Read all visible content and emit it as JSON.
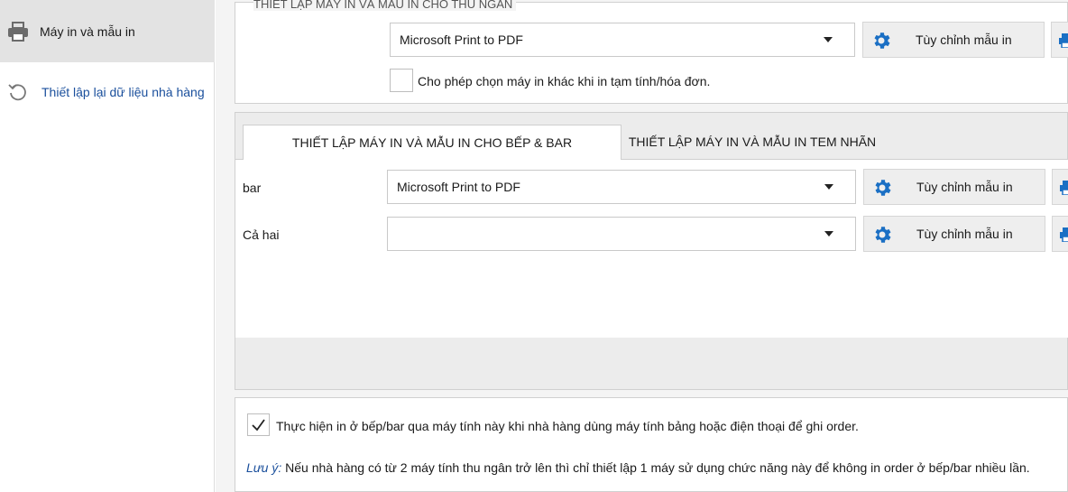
{
  "sidebar": {
    "items": [
      {
        "label": "Máy in và mẫu in",
        "icon": "printer-icon",
        "active": true
      },
      {
        "label": "Thiết lập lại dữ liệu nhà hàng",
        "icon": "reset-icon",
        "active": false
      }
    ]
  },
  "cashier": {
    "title": "THIẾT LẬP MÁY IN VÀ MẪU IN CHO THU NGÂN",
    "printer_value": "Microsoft Print to PDF",
    "customize_label": "Tùy chỉnh mẫu in",
    "allow_other_label": "Cho phép chọn máy in khác khi in tạm tính/hóa đơn.",
    "allow_other_checked": false
  },
  "tabs": [
    {
      "label": "THIẾT LẬP MÁY IN VÀ MẪU IN CHO BẾP & BAR",
      "active": true
    },
    {
      "label": "THIẾT LẬP MÁY IN VÀ MẪU IN TEM NHÃN",
      "active": false
    }
  ],
  "kitchen_rows": [
    {
      "label": "bar",
      "printer_value": "Microsoft Print to PDF",
      "customize_label": "Tùy chỉnh mẫu in"
    },
    {
      "label": "Cả hai",
      "printer_value": "",
      "customize_label": "Tùy chỉnh mẫu in"
    }
  ],
  "footer": {
    "remote_print_label": "Thực hiện in ở bếp/bar qua máy tính này khi nhà hàng dùng máy tính bảng hoặc điện thoại để ghi order.",
    "remote_print_checked": true,
    "note_prefix": "Lưu ý:",
    "note_text": " Nếu nhà hàng có từ 2 máy tính thu ngân trở lên thì chỉ thiết lập 1 máy sử dụng chức năng này để không in order ở bếp/bar nhiều lần."
  },
  "colors": {
    "accent_blue": "#1a6fc4",
    "link_blue": "#1a4f9c",
    "sidebar_active": "#e3e3e3"
  }
}
